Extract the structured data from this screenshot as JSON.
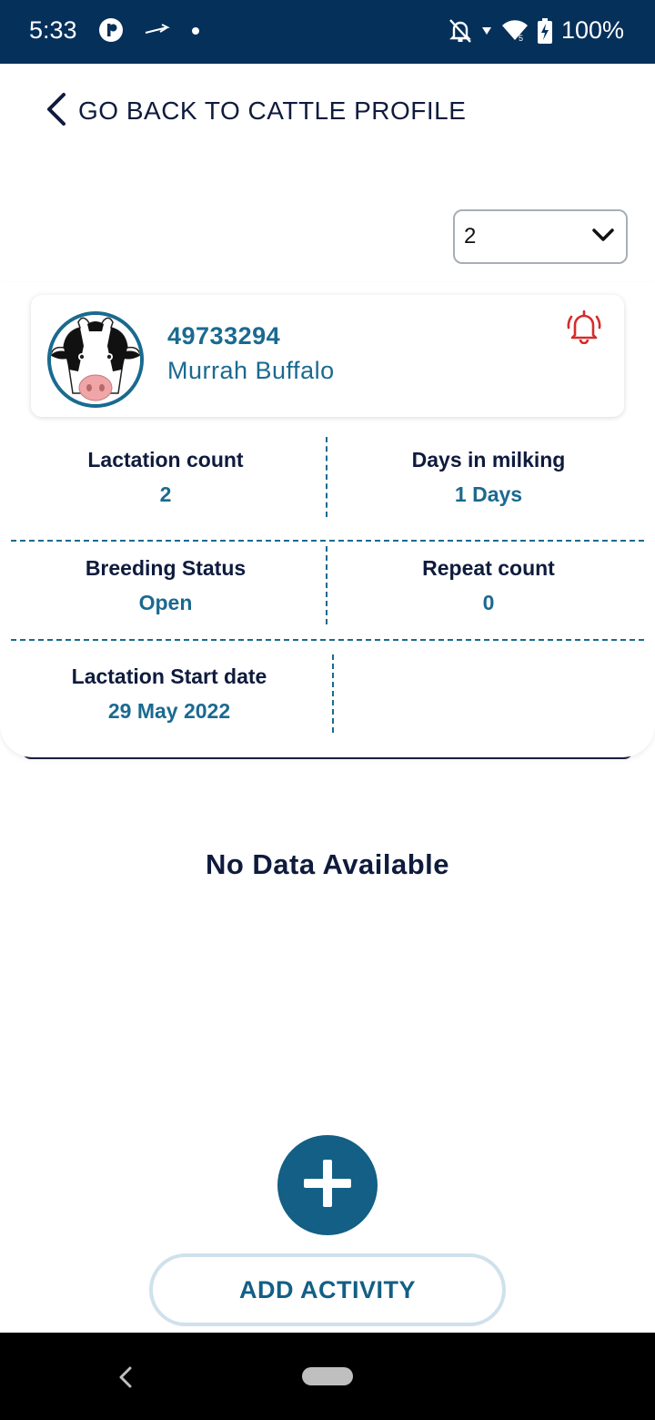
{
  "status_bar": {
    "time": "5:33",
    "battery": "100%",
    "icons": [
      "app-p-icon",
      "plane-arrow-icon",
      "dot-icon",
      "bell-off-icon",
      "wifi-icon",
      "battery-charging-icon"
    ]
  },
  "nav": {
    "back_label": "GO BACK TO CATTLE PROFILE"
  },
  "dropdown": {
    "value": "2"
  },
  "cattle": {
    "id": "49733294",
    "breed": "Murrah  Buffalo"
  },
  "stats": {
    "lactation_count_label": "Lactation count",
    "lactation_count_value": "2",
    "days_in_milking_label": "Days in milking",
    "days_in_milking_value": "1 Days",
    "breeding_status_label": "Breeding Status",
    "breeding_status_value": "Open",
    "repeat_count_label": "Repeat count",
    "repeat_count_value": "0",
    "lactation_start_label": "Lactation Start date",
    "lactation_start_value": "29 May 2022"
  },
  "empty_state": "No Data Available",
  "actions": {
    "add_activity_label": "ADD ACTIVITY"
  },
  "colors": {
    "status_bar": "#05305a",
    "accent": "#1a6a90",
    "alarm": "#d62b2b",
    "text_dark": "#0f1b3d"
  }
}
